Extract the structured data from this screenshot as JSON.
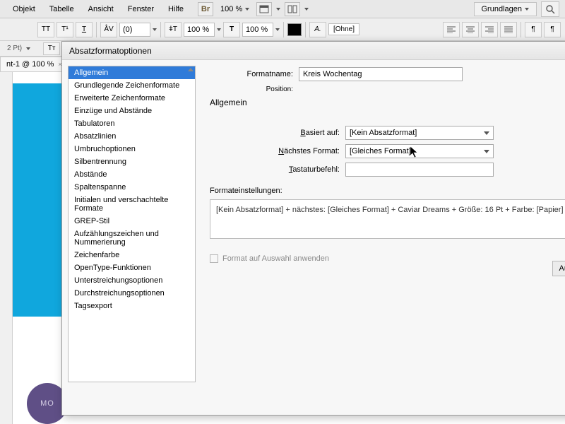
{
  "menu": {
    "objekt": "Objekt",
    "tabelle": "Tabelle",
    "ansicht": "Ansicht",
    "fenster": "Fenster",
    "hilfe": "Hilfe",
    "zoom": "100 %",
    "workspace": "Grundlagen"
  },
  "toolbar": {
    "kerning": "(0)",
    "zoom1": "100 %",
    "zoom2": "100 %",
    "ohne": "[Ohne]"
  },
  "document": {
    "tab": "nt-1 @ 100 %"
  },
  "logo": "MO",
  "dialog": {
    "title": "Absatzformatoptionen",
    "categories": [
      "Allgemein",
      "Grundlegende Zeichenformate",
      "Erweiterte Zeichenformate",
      "Einzüge und Abstände",
      "Tabulatoren",
      "Absatzlinien",
      "Umbruchoptionen",
      "Silbentrennung",
      "Abstände",
      "Spaltenspanne",
      "Initialen und verschachtelte Formate",
      "GREP-Stil",
      "Aufzählungszeichen und Nummerierung",
      "Zeichenfarbe",
      "OpenType-Funktionen",
      "Unterstreichungsoptionen",
      "Durchstreichungsoptionen",
      "Tagsexport"
    ],
    "labels": {
      "formatname": "Formatname:",
      "position": "Position:",
      "section": "Allgemein",
      "basiert": "Basiert auf:",
      "naechstes": "Nächstes Format:",
      "tastatur": "Tastaturbefehl:",
      "einstellungen": "Formateinstellungen:",
      "applySel": "Format auf Auswahl anwenden",
      "aufBasis": "Auf"
    },
    "values": {
      "formatname": "Kreis Wochentag",
      "basiert": "[Kein Absatzformat]",
      "naechstes": "[Gleiches Format]",
      "tastatur": "",
      "summary": "[Kein Absatzformat] + nächstes: [Gleiches Format] + Caviar Dreams + Größe: 16 Pt + Farbe: [Papier] +"
    }
  }
}
